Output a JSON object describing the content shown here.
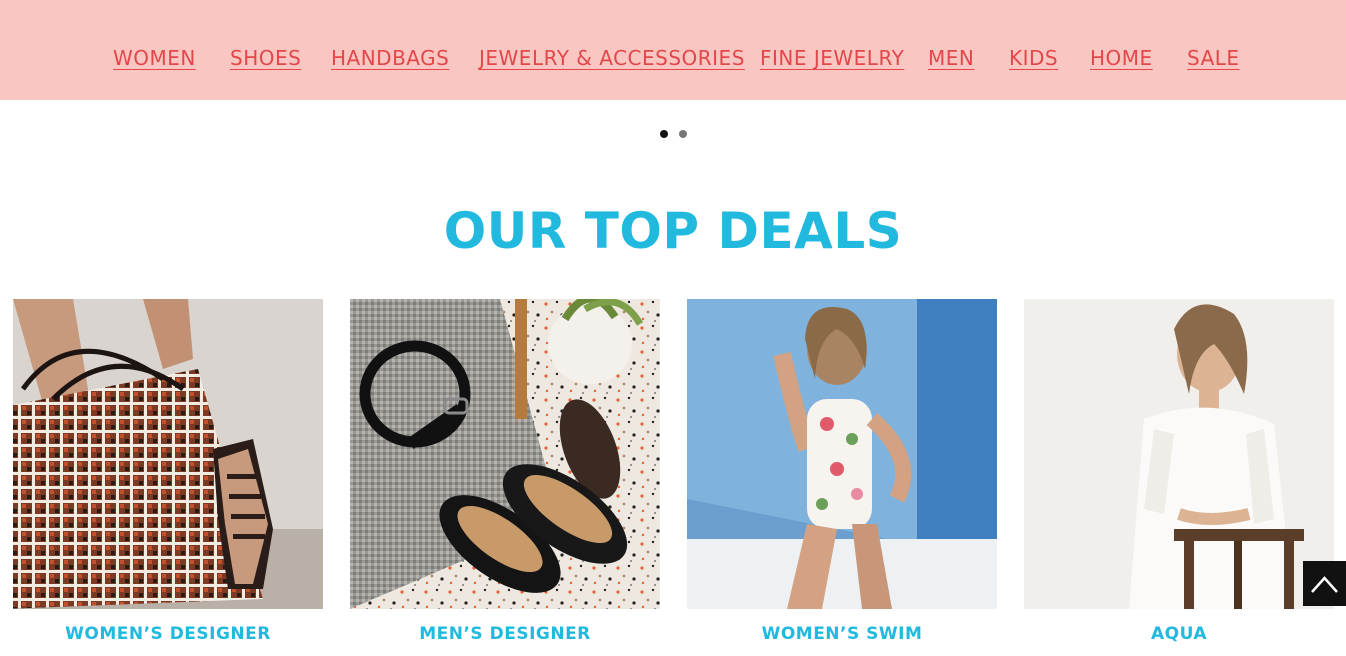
{
  "nav": {
    "items": [
      {
        "label": "WOMEN"
      },
      {
        "label": "SHOES"
      },
      {
        "label": "HANDBAGS"
      },
      {
        "label": "JEWELRY & ACCESSORIES"
      },
      {
        "label": "FINE JEWELRY"
      },
      {
        "label": "MEN"
      },
      {
        "label": "KIDS"
      },
      {
        "label": "HOME"
      },
      {
        "label": "SALE"
      }
    ]
  },
  "carousel": {
    "slide_count": 2,
    "active_index": 0
  },
  "deals": {
    "title": "OUR TOP DEALS",
    "cards": [
      {
        "label": "WOMEN’S DESIGNER"
      },
      {
        "label": "MEN’S DESIGNER"
      },
      {
        "label": "WOMEN’S SWIM"
      },
      {
        "label": "AQUA"
      }
    ]
  },
  "icons": {
    "back_to_top": "arrow-up-icon"
  },
  "colors": {
    "banner": "#f9c6c1",
    "nav_text": "#e2474c",
    "accent": "#22b9df"
  }
}
